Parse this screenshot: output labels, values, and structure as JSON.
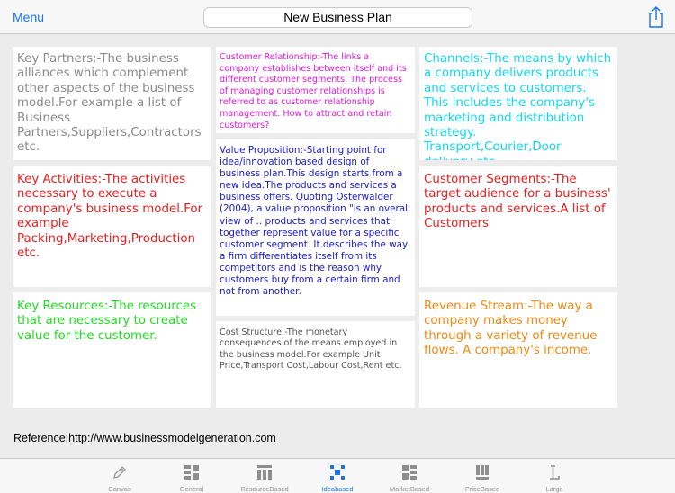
{
  "header": {
    "menu_label": "Menu",
    "title": "New Business Plan"
  },
  "canvas": {
    "key_partners": "Key Partners:-The business alliances which complement other aspects of the business model.For example a list of Business Partners,Suppliers,Contractors etc.",
    "customer_relationship": "Customer Relationship:-The links a company establishes between itself and its different customer segments. The process of managing customer relationships is referred to as customer relationship management. How to attract and retain customers?",
    "channels": "Channels:-The means by which a company delivers products and services to customers. This includes the company's marketing and  distribution strategy. Transport,Courier,Door delivery etc.",
    "key_activities": "Key Activities:-The activities necessary to execute a company's business model.For example Packing,Marketing,Production etc.",
    "value_proposition": "Value Proposition:-Starting point for idea/innovation based design of business plan.This design starts from a new idea.The products and services a business offers. Quoting Osterwalder (2004), a value proposition \"is an overall view of .. products and services that together represent value for a specific customer segment. It describes the way a firm differentiates itself from its competitors and is the reason why customers buy from a certain firm and not from another.",
    "customer_segments": "Customer Segments:-The target audience for a business' products and services.A list of Customers",
    "key_resources": "Key Resources:-The resources that are necessary to create value for the customer.",
    "cost_structure": "Cost Structure:-The monetary consequences of the means employed in the business model.For example Unit Price,Transport Cost,Labour Cost,Rent etc.",
    "revenue_stream": "Revenue Stream:-The way a company makes money through a variety of revenue flows. A company's income."
  },
  "reference": "Reference:http://www.businessmodelgeneration.com",
  "tabs": [
    {
      "label": "Canvas",
      "icon": "pencil-icon"
    },
    {
      "label": "General",
      "icon": "grid-blocks-icon"
    },
    {
      "label": "ResourceBased",
      "icon": "columns-icon"
    },
    {
      "label": "Ideabased",
      "icon": "dots-cluster-icon",
      "active": true
    },
    {
      "label": "MarketBased",
      "icon": "cross-blocks-icon"
    },
    {
      "label": "PriceBased",
      "icon": "bars-icon"
    },
    {
      "label": "Large",
      "icon": "letter-l-icon"
    }
  ],
  "colors": {
    "accent": "#1a73e8",
    "partners": "#8a8a8a",
    "relationship": "#e21ad8",
    "channels": "#12d8ee",
    "activities": "#e81e1e",
    "value": "#1a1acb",
    "segments": "#e81e1e",
    "resources": "#22dc22",
    "cost": "#555555",
    "revenue": "#ef8a14"
  }
}
